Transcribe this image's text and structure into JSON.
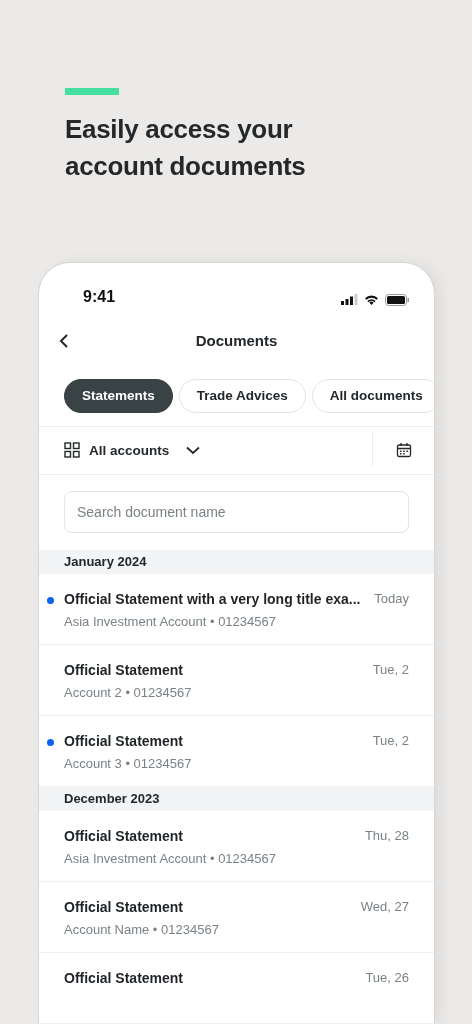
{
  "headline": "Easily access your account documents",
  "status_bar": {
    "time": "9:41"
  },
  "nav": {
    "title": "Documents"
  },
  "tabs": [
    {
      "label": "Statements",
      "selected": true
    },
    {
      "label": "Trade Advices",
      "selected": false
    },
    {
      "label": "All documents",
      "selected": false
    }
  ],
  "filter": {
    "label": "All accounts"
  },
  "search": {
    "placeholder": "Search document name"
  },
  "sections": [
    {
      "title": "January 2024",
      "items": [
        {
          "title": "Official Statement with a very long title exa...",
          "subtitle": "Asia Investment Account • 01234567",
          "date": "Today",
          "unread": true
        },
        {
          "title": "Official Statement",
          "subtitle": "Account 2 • 01234567",
          "date": "Tue, 2",
          "unread": false
        },
        {
          "title": "Official Statement",
          "subtitle": "Account 3 • 01234567",
          "date": "Tue, 2",
          "unread": true
        }
      ]
    },
    {
      "title": "December 2023",
      "items": [
        {
          "title": "Official Statement",
          "subtitle": "Asia Investment Account • 01234567",
          "date": "Thu, 28",
          "unread": false
        },
        {
          "title": "Official Statement",
          "subtitle": "Account Name • 01234567",
          "date": "Wed, 27",
          "unread": false
        },
        {
          "title": "Official Statement",
          "date": "Tue, 26",
          "unread": false
        }
      ]
    }
  ]
}
